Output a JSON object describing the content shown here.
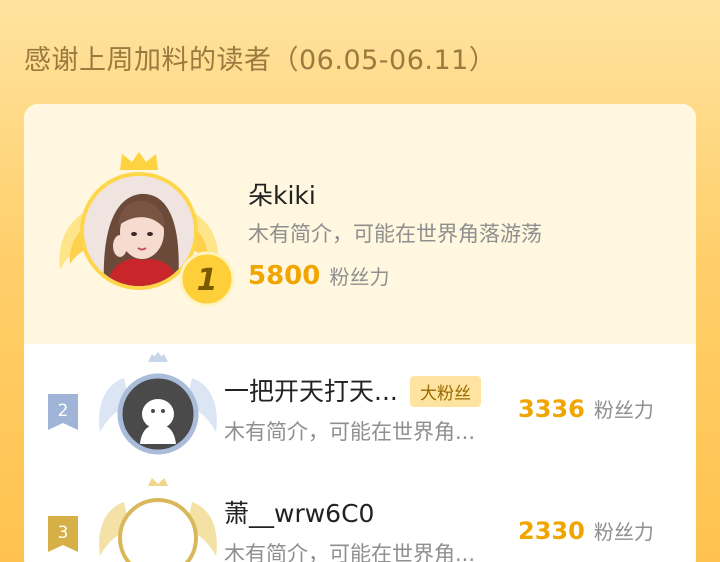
{
  "heading": "感谢上周加料的读者（06.05-06.11）",
  "top_reader": {
    "rank": "1",
    "name": "朵kiki",
    "intro": "木有简介，可能在世界角落游荡",
    "score": "5800",
    "score_unit": "粉丝力"
  },
  "readers": [
    {
      "rank": "2",
      "name": "一把开天打天...",
      "badge": "大粉丝",
      "intro": "木有简介，可能在世界角...",
      "score": "3336",
      "score_unit": "粉丝力"
    },
    {
      "rank": "3",
      "name": "萧__wrw6C0",
      "intro": "木有简介，可能在世界角...",
      "score": "2330",
      "score_unit": "粉丝力"
    }
  ],
  "colors": {
    "accent": "#f0a500",
    "heading": "#9b7a3f",
    "gold": "#ffd54a",
    "silver": "#b8c8e0",
    "bronze": "#d8b24a"
  }
}
